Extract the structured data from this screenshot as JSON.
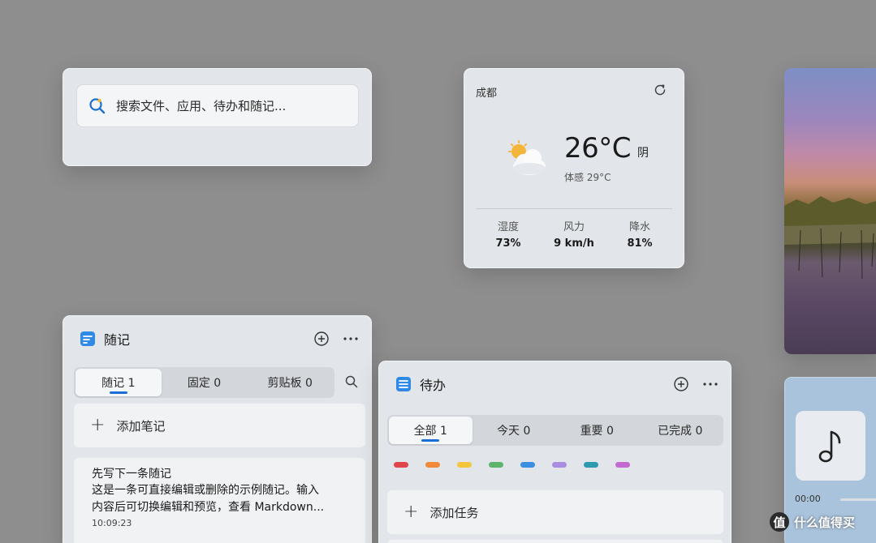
{
  "search": {
    "placeholder": "搜索文件、应用、待办和随记..."
  },
  "weather": {
    "city": "成都",
    "temperature": "26°C",
    "condition": "阴",
    "feels_like": "体感 29°C",
    "stats": [
      {
        "label": "湿度",
        "value": "73%"
      },
      {
        "label": "风力",
        "value": "9 km/h"
      },
      {
        "label": "降水",
        "value": "81%"
      }
    ]
  },
  "music": {
    "time": "00:00"
  },
  "notes": {
    "title": "随记",
    "tabs": [
      {
        "label": "随记 1",
        "active": true
      },
      {
        "label": "固定 0",
        "active": false
      },
      {
        "label": "剪贴板 0",
        "active": false
      }
    ],
    "add_label": "添加笔记",
    "items": [
      {
        "title": "先写下一条随记",
        "body_line1": "这是一条可直接编辑或删除的示例随记。输入",
        "body_line2": "内容后可切换编辑和预览，查看 Markdown...",
        "time": "10:09:23"
      }
    ]
  },
  "todo": {
    "title": "待办",
    "tabs": [
      {
        "label": "全部 1",
        "active": true
      },
      {
        "label": "今天 0",
        "active": false
      },
      {
        "label": "重要 0",
        "active": false
      },
      {
        "label": "已完成 0",
        "active": false
      }
    ],
    "colors": [
      "#e0474c",
      "#f08a3a",
      "#f2c53d",
      "#5cb56a",
      "#3b8fe0",
      "#a98de0",
      "#2e9ab0",
      "#c36ad0"
    ],
    "add_label": "添加任务"
  },
  "accent_color": "#1a6fd6",
  "watermark": {
    "badge": "值",
    "text": "什么值得买"
  }
}
